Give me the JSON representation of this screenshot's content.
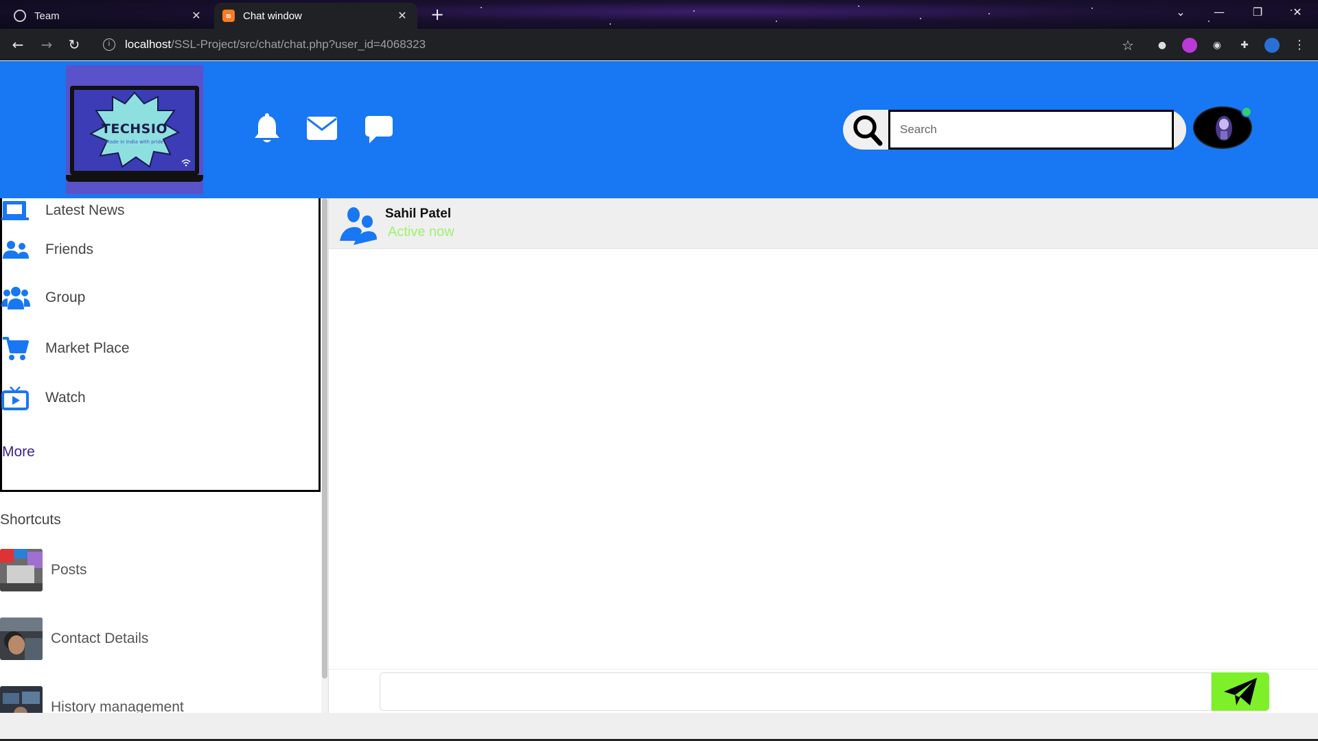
{
  "browser": {
    "tabs": [
      {
        "title": "Team",
        "icon": "globe-icon"
      },
      {
        "title": "Chat window",
        "icon": "xampp-icon",
        "active": true
      }
    ],
    "url_host": "localhost",
    "url_path": "/SSL-Project/src/chat/chat.php?user_id=4068323"
  },
  "header": {
    "logo_text": "TECHSIO",
    "logo_tagline": "Made in India with pride",
    "search_placeholder": "Search",
    "colors": {
      "brand": "#1877f2",
      "online": "#31d06b"
    }
  },
  "sidebar": {
    "menu": [
      {
        "label": "Latest News",
        "icon": "news-icon"
      },
      {
        "label": "Friends",
        "icon": "friends-icon"
      },
      {
        "label": "Group",
        "icon": "group-icon"
      },
      {
        "label": "Market Place",
        "icon": "cart-icon"
      },
      {
        "label": "Watch",
        "icon": "tv-icon"
      }
    ],
    "more_label": "More",
    "shortcuts_title": "Shortcuts",
    "shortcuts": [
      {
        "label": "Posts"
      },
      {
        "label": "Contact Details"
      },
      {
        "label": "History management"
      }
    ]
  },
  "chat": {
    "contact_name": "Sahil Patel",
    "status": "Active now",
    "status_color": "#9cf26c",
    "message_value": "",
    "send_color": "#7df02a"
  }
}
